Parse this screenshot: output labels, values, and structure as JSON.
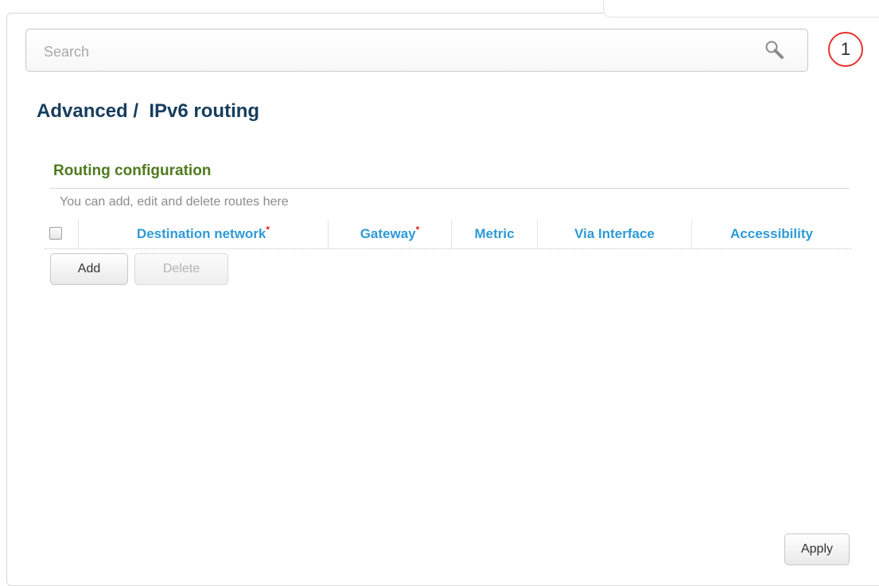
{
  "search": {
    "placeholder": "Search"
  },
  "notifications": {
    "count": "1"
  },
  "breadcrumb": {
    "title": "Advanced /  IPv6 routing"
  },
  "section": {
    "title": "Routing configuration",
    "description": "You can add, edit and delete routes here"
  },
  "table": {
    "columns": [
      {
        "label": "Destination network",
        "required": "*"
      },
      {
        "label": "Gateway",
        "required": "*"
      },
      {
        "label": "Metric"
      },
      {
        "label": "Via Interface"
      },
      {
        "label": "Accessibility"
      }
    ],
    "rows": []
  },
  "buttons": {
    "add": "Add",
    "delete": "Delete",
    "apply": "Apply"
  },
  "colors": {
    "title": "#163d5e",
    "section": "#4f7a1e",
    "column_header": "#2e9ad6",
    "required_mark": "#e02020",
    "notification_ring": "#e8312f"
  }
}
